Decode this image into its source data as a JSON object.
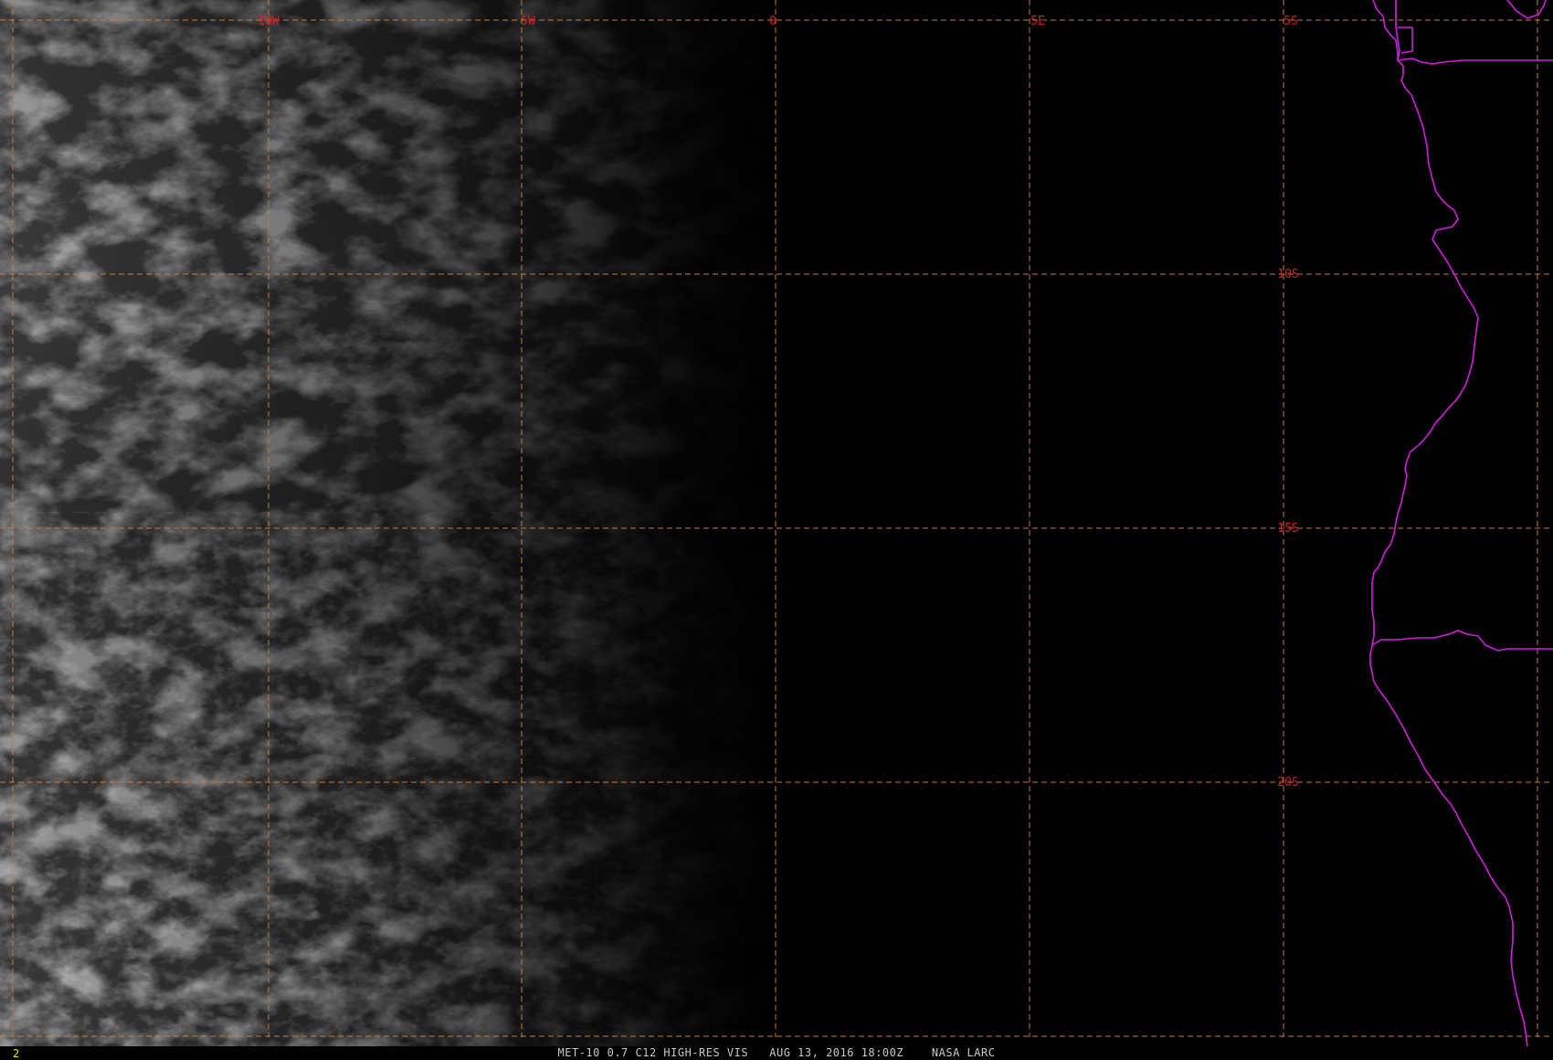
{
  "image": {
    "frame_number": "2",
    "caption": "MET-10 0.7 C12 HIGH-RES VIS   AUG 13, 2016 18:00Z    NASA LARC"
  },
  "grid": {
    "longitude_labels": [
      "10W",
      "5W",
      "0",
      "5E"
    ],
    "latitude_labels": [
      "5S",
      "10S",
      "15S",
      "20S"
    ],
    "line_color": "#c8783c",
    "label_color": "#d42020"
  },
  "coastline": {
    "color": "#d21edc"
  },
  "colors": {
    "background": "#000000",
    "caption_text": "#c8c8c8",
    "frame_number_text": "#e8e000"
  }
}
